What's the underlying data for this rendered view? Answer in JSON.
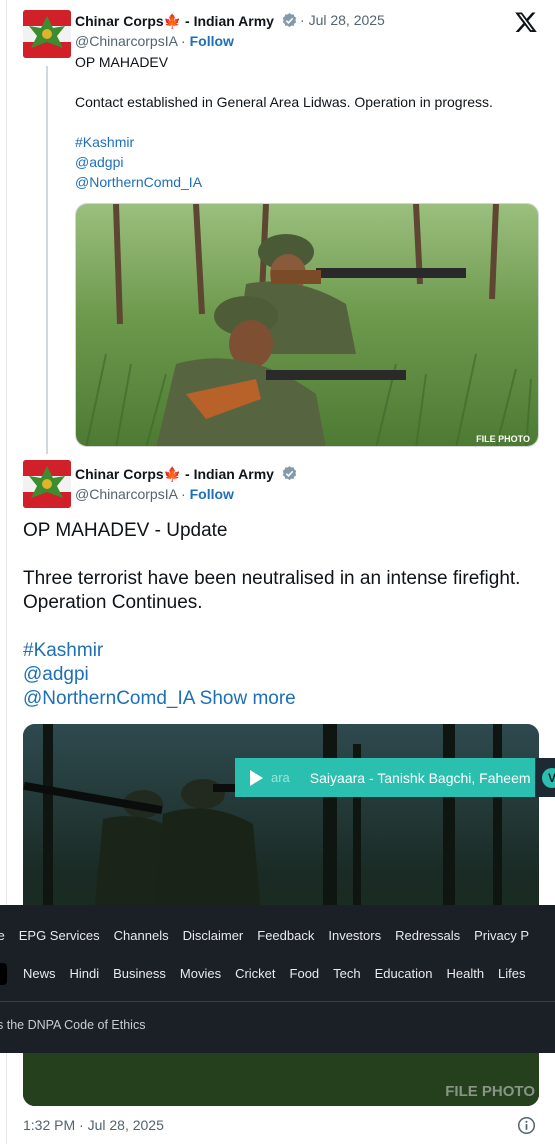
{
  "tweet1": {
    "author_name": "Chinar Corps",
    "author_suffix": " - Indian Army",
    "date": "Jul 28, 2025",
    "handle": "@ChinarcorpsIA",
    "follow": "Follow",
    "lines": [
      "OP MAHADEV",
      "",
      "Contact established in General Area Lidwas. Operation in progress.",
      ""
    ],
    "hashtag": "#Kashmir",
    "mention1": "@adgpi",
    "mention2": "@NorthernComd_IA",
    "image_label": "FILE PHOTO"
  },
  "tweet2": {
    "author_name": "Chinar Corps",
    "author_suffix": " - Indian Army",
    "handle": "@ChinarcorpsIA",
    "follow": "Follow",
    "line1": "OP MAHADEV - Update",
    "line2": "Three terrorist have been neutralised in an intense firefight. Operation Continues.",
    "hashtag": "#Kashmir",
    "mention1": "@adgpi",
    "mention2": "@NorthernComd_IA",
    "show_more": "Show more",
    "image_label": "FILE PHOTO",
    "timestamp": "1:32 PM · Jul 28, 2025"
  },
  "player": {
    "ghost": "ara",
    "title": "Saiyaara - Tanishk Bagchi, Faheem",
    "badge": "V"
  },
  "footer": {
    "row1": [
      "se",
      "EPG Services",
      "Channels",
      "Disclaimer",
      "Feedback",
      "Investors",
      "Redressals",
      "Privacy P"
    ],
    "row2": [
      "News",
      "Hindi",
      "Business",
      "Movies",
      "Cricket",
      "Food",
      "Tech",
      "Education",
      "Health",
      "Lifes"
    ],
    "ethics": "s the DNPA Code of Ethics"
  },
  "colors": {
    "link": "#1d6fb8",
    "player": "#2bbfb0",
    "footer_bg": "#1b1f26",
    "avatar_red": "#d1202a"
  }
}
